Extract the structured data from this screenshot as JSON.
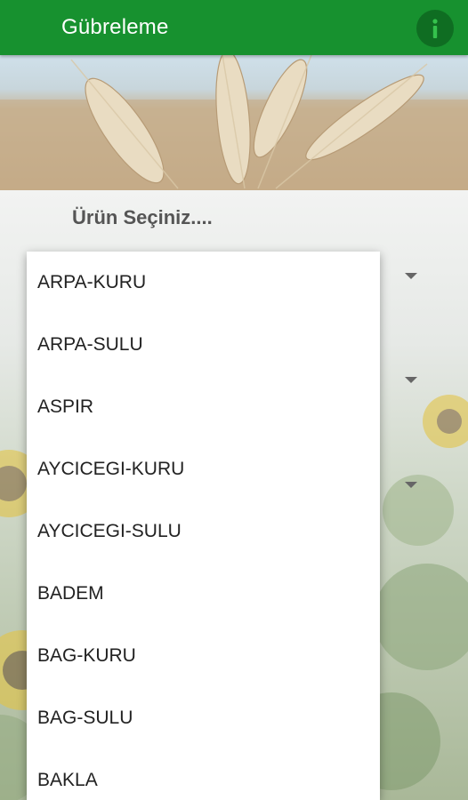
{
  "toolbar": {
    "title": "Gübreleme",
    "info_icon": "info-icon",
    "color": "#17912f"
  },
  "form": {
    "prompt": "Ürün Seçiniz...."
  },
  "dropdown": {
    "options": [
      "ARPA-KURU",
      "ARPA-SULU",
      "ASPIR",
      "AYCICEGI-KURU",
      "AYCICEGI-SULU",
      "BADEM",
      "BAG-KURU",
      "BAG-SULU",
      "BAKLA"
    ]
  }
}
